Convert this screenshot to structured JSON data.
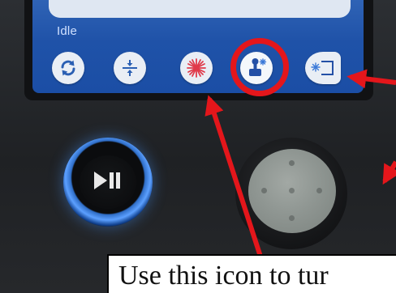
{
  "screen": {
    "status": "Idle"
  },
  "toolbar": {
    "buttons": [
      {
        "name": "refresh-icon",
        "selected": false
      },
      {
        "name": "focus-icon",
        "selected": false
      },
      {
        "name": "laser-pointer-icon",
        "selected": false
      },
      {
        "name": "jog-control-icon",
        "selected": true
      },
      {
        "name": "frame-icon",
        "selected": false
      }
    ]
  },
  "annotation": {
    "text": "Use this icon to tur",
    "highlight_color": "#e4161b"
  },
  "colors": {
    "screen_blue": "#1f52a8",
    "highlight_red": "#e4161b",
    "ring_blue": "#5ca0ff"
  }
}
